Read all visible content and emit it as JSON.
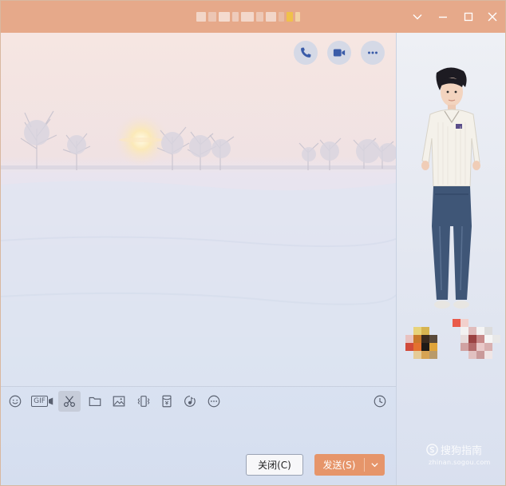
{
  "window": {
    "title": "",
    "controls": {
      "collapse_icon": "chevron-down-icon",
      "minimize_icon": "minimize-icon",
      "maximize_icon": "maximize-icon",
      "close_icon": "close-icon"
    }
  },
  "header_actions": [
    {
      "name": "voice-call-button",
      "icon": "phone-icon"
    },
    {
      "name": "video-call-button",
      "icon": "video-camera-icon"
    },
    {
      "name": "more-button",
      "icon": "more-dots-icon"
    }
  ],
  "toolbar": {
    "gif_label": "GIF",
    "tools": [
      {
        "name": "emoji",
        "icon": "smiley-icon"
      },
      {
        "name": "gif",
        "icon": "gif-icon"
      },
      {
        "name": "screenshot",
        "icon": "scissors-icon",
        "active": true
      },
      {
        "name": "file",
        "icon": "folder-icon"
      },
      {
        "name": "image",
        "icon": "image-icon"
      },
      {
        "name": "shake",
        "icon": "vibrate-icon"
      },
      {
        "name": "red-packet",
        "icon": "red-packet-icon"
      },
      {
        "name": "music",
        "icon": "music-icon"
      },
      {
        "name": "more",
        "icon": "more-circle-icon"
      }
    ],
    "history_icon": "clock-icon"
  },
  "buttons": {
    "close_label": "关闭(C)",
    "send_label": "发送(S)",
    "send_dropdown_icon": "chevron-down-icon"
  },
  "watermark": {
    "brand": "搜狗指南",
    "url": "zhinan.sogou.com"
  },
  "colors": {
    "titlebar": "#e6a98a",
    "send_button": "#e6956a",
    "icon_color": "#3a5ba8"
  }
}
